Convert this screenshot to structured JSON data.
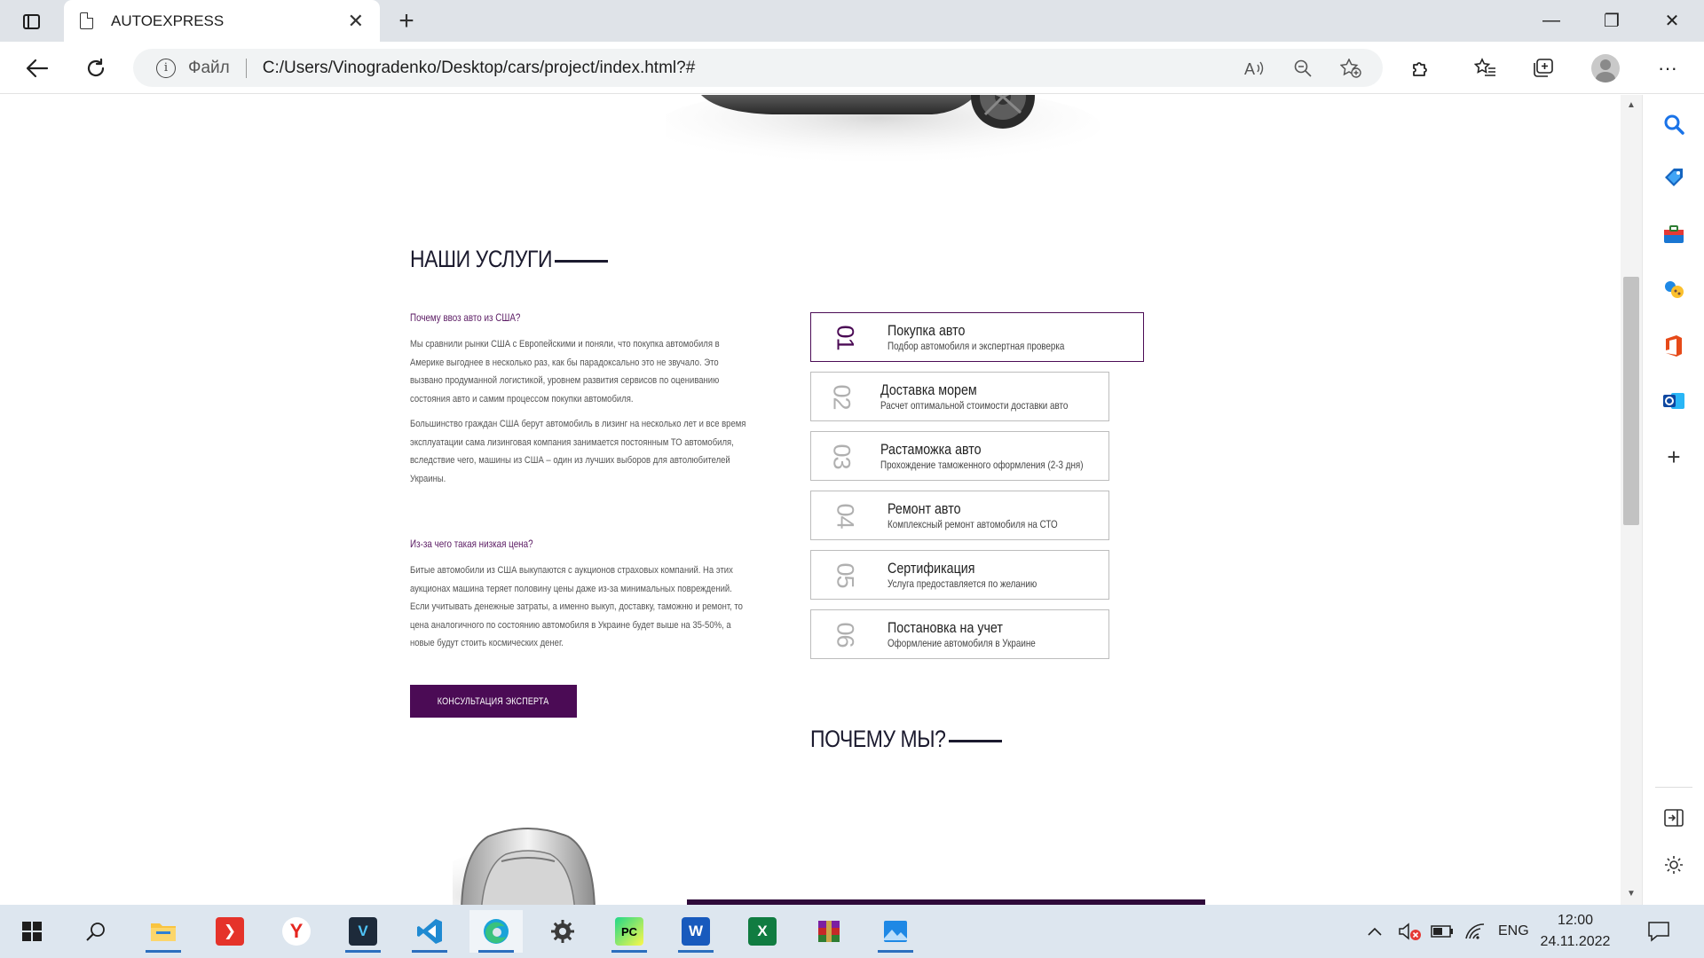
{
  "browser": {
    "tab_title": "AUTOEXPRESS",
    "tab_close": "✕",
    "new_tab": "+",
    "file_label": "Файл",
    "url": "C:/Users/Vinogradenko/Desktop/cars/project/index.html?#",
    "window_controls": {
      "minimize": "—",
      "maximize": "❐",
      "close": "✕"
    },
    "more_menu": "···"
  },
  "services_section": {
    "title": "НАШИ УСЛУГИ",
    "why_usa": {
      "question": "Почему ввоз авто из США?",
      "paragraphs": [
        "Мы сравнили рынки США с Европейскими и поняли, что покупка автомобиля в Америке выгоднее в несколько раз, как бы парадоксально это не звучало. Это вызвано продуманной логистикой, уровнем развития сервисов по оцениванию состояния авто и самим процессом покупки автомобиля.",
        "Большинство граждан США берут автомобиль в лизинг на несколько лет и все время эксплуатации сама лизинговая компания занимается постоянным ТО автомобиля, вследствие чего, машины из США – один из лучших выборов для автолюбителей Украины."
      ]
    },
    "low_price": {
      "question": "Из-за чего такая низкая цена?",
      "paragraphs": [
        "Битые автомобили из США выкупаются с аукционов страховых компаний. На этих аукционах машина теряет половину цены даже из-за минимальных повреждений. Если учитывать денежные затраты, а именно выкуп, доставку, таможню и ремонт, то цена аналогичного по состоянию автомобиля в Украине будет выше на 35-50%, а новые будут стоить космических денег."
      ]
    },
    "cta_label": "КОНСУЛЬТАЦИЯ ЭКСПЕРТА",
    "items": [
      {
        "num": "01",
        "title": "Покупка авто",
        "subtitle": "Подбор автомобиля и экспертная проверка",
        "active": true
      },
      {
        "num": "02",
        "title": "Доставка морем",
        "subtitle": "Расчет оптимальной стоимости доставки авто",
        "active": false
      },
      {
        "num": "03",
        "title": "Растаможка авто",
        "subtitle": "Прохождение таможенного оформления (2-3 дня)",
        "active": false
      },
      {
        "num": "04",
        "title": "Ремонт авто",
        "subtitle": "Комплексный ремонт автомобиля на СТО",
        "active": false
      },
      {
        "num": "05",
        "title": "Сертификация",
        "subtitle": "Услуга предоставляется по желанию",
        "active": false
      },
      {
        "num": "06",
        "title": "Постановка на учет",
        "subtitle": "Оформление автомобиля в Украине",
        "active": false
      }
    ]
  },
  "why_section": {
    "title": "ПОЧЕМУ МЫ?"
  },
  "taskbar": {
    "language": "ENG",
    "time": "12:00",
    "date": "24.11.2022"
  },
  "colors": {
    "accent": "#4b0b55",
    "title": "#1b1a2e",
    "border": "#bdbdbd"
  }
}
